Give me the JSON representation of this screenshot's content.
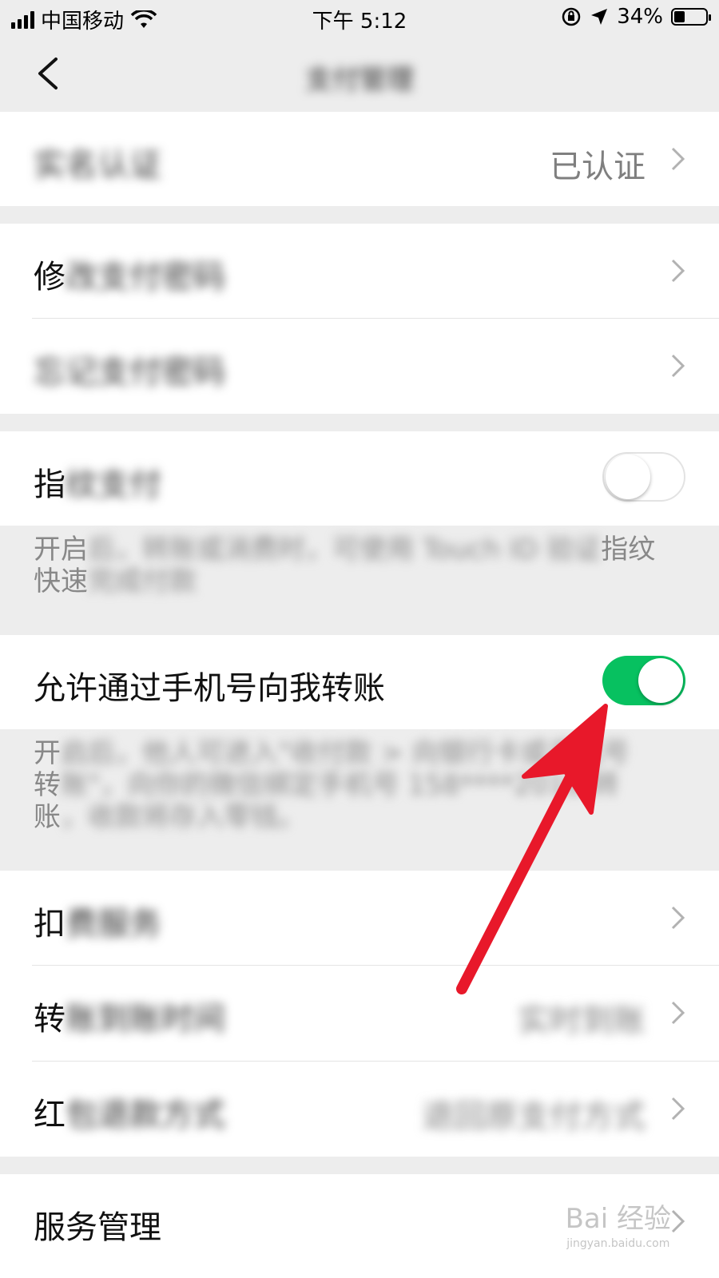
{
  "status_bar": {
    "carrier": "中国移动",
    "time": "下午 5:12",
    "battery": "34%",
    "battery_level": 0.34
  },
  "nav": {
    "title": "支付管理"
  },
  "groups": {
    "real_name": {
      "label": "实名认证",
      "value": "已认证"
    },
    "modify_password": {
      "label_visible": "修",
      "label_blurred": "改支付密码"
    },
    "forgot_password": {
      "label_blurred": "忘记支付密码"
    },
    "fingerprint": {
      "label_visible": "指",
      "label_blurred": "纹支付",
      "enabled": false,
      "desc_line1_visible": "开启",
      "desc_line1_blurred": "后，转账或消费时，可使用 Touch ID 验证",
      "desc_line1_end": "指纹",
      "desc_line2_visible": "快速",
      "desc_line2_blurred": "完成付款"
    },
    "phone_transfer": {
      "label": "允许通过手机号向我转账",
      "enabled": true,
      "desc_line1_visible": "开",
      "desc_line1_blurred": "启后，他人可进入\"收付款 > 向银行卡或手机号",
      "desc_line2_visible": "转",
      "desc_line2_blurred": "账\"，向你的微信绑定手机号 158****2018 转",
      "desc_line3_visible": "账",
      "desc_line3_blurred": "，收款将存入零钱。"
    },
    "deduction": {
      "label_visible": "扣",
      "label_blurred": "费服务"
    },
    "arrival_time": {
      "label_visible": "转",
      "label_blurred": "账到账时间",
      "value": "实时到账"
    },
    "refund_method": {
      "label_visible": "红",
      "label_blurred": "包退款方式",
      "value": "退回原支付方式"
    },
    "service": {
      "label": "服务管理"
    }
  },
  "watermark": {
    "text": "Bai 经验",
    "sub": "jingyan.baidu.com"
  },
  "colors": {
    "toggle_on": "#07c160",
    "annotation_arrow": "#e8182a"
  }
}
